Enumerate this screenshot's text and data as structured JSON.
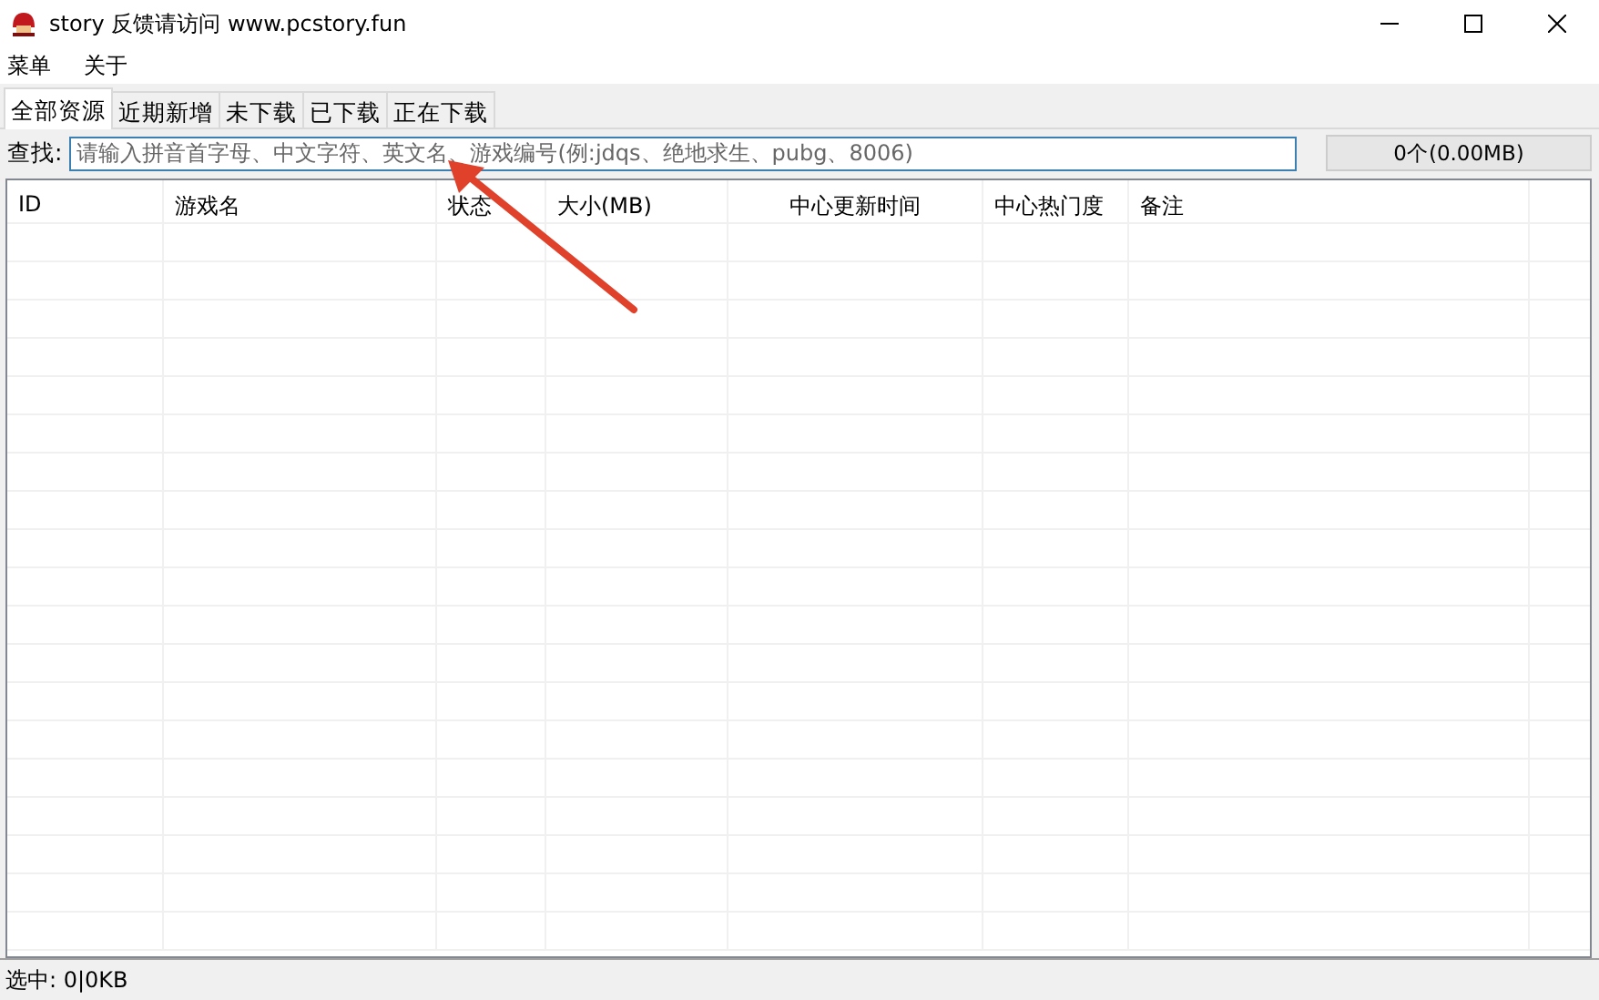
{
  "window": {
    "title": "story 反馈请访问 www.pcstory.fun"
  },
  "menu": [
    "菜单",
    "关于"
  ],
  "tabs": [
    {
      "label": "全部资源",
      "selected": true
    },
    {
      "label": "近期新增",
      "selected": false
    },
    {
      "label": "未下载",
      "selected": false
    },
    {
      "label": "已下载",
      "selected": false
    },
    {
      "label": "正在下载",
      "selected": false
    }
  ],
  "search": {
    "label": "查找:",
    "placeholder": "请输入拼音首字母、中文字符、英文名、游戏编号(例:jdqs、绝地求生、pubg、8006)"
  },
  "summary": "0个(0.00MB)",
  "table": {
    "columns": [
      "ID",
      "游戏名",
      "状态",
      "大小(MB)",
      "中心更新时间",
      "中心热门度",
      "备注"
    ]
  },
  "status_bar": "选中: 0|0KB"
}
